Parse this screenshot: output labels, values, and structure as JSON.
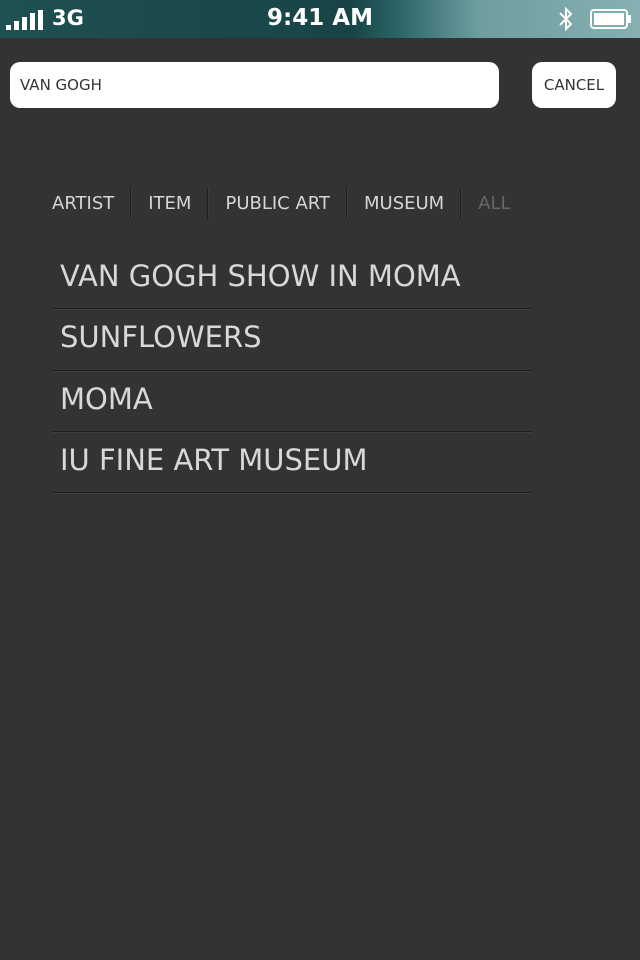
{
  "status_bar": {
    "network": "3G",
    "time": "9:41 AM"
  },
  "search": {
    "value": "VAN GOGH",
    "cancel_label": "CANCEL"
  },
  "filters": [
    {
      "label": "ARTIST",
      "active": true
    },
    {
      "label": "ITEM",
      "active": true
    },
    {
      "label": "PUBLIC ART",
      "active": true
    },
    {
      "label": "MUSEUM",
      "active": true
    },
    {
      "label": "ALL",
      "active": false
    }
  ],
  "results": [
    {
      "label": "VAN GOGH SHOW IN MOMA"
    },
    {
      "label": "SUNFLOWERS"
    },
    {
      "label": "MOMA"
    },
    {
      "label": "IU FINE ART MUSEUM"
    }
  ],
  "colors": {
    "background": "#333333",
    "text": "#d8d8d8",
    "inactive_tab": "#666666",
    "status_bar": "#1f5052"
  }
}
